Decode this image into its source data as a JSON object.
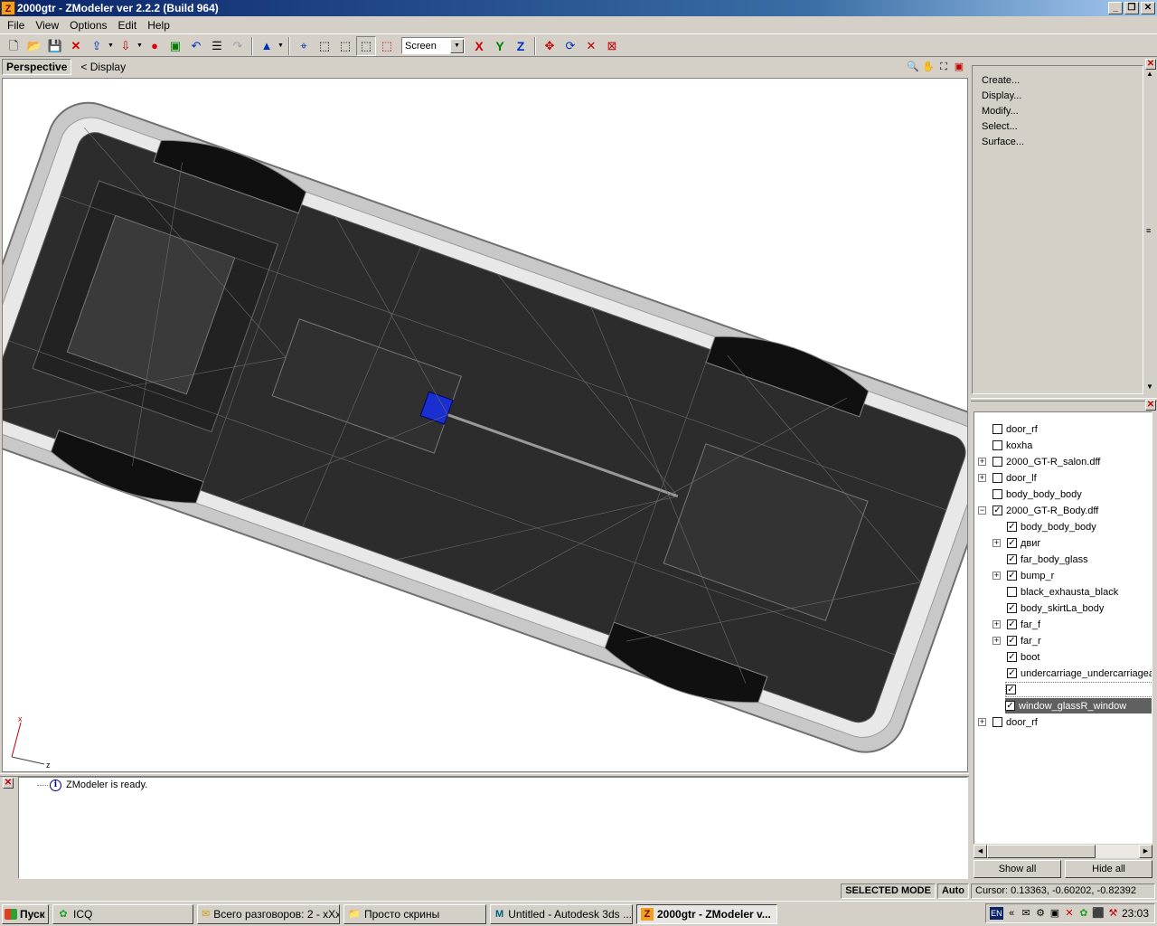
{
  "window": {
    "title": "2000gtr - ZModeler ver 2.2.2 (Build 964)",
    "app_icon": "Z"
  },
  "menu": [
    "File",
    "View",
    "Options",
    "Edit",
    "Help"
  ],
  "toolbar": {
    "view_mode": "Screen",
    "x_label": "X",
    "y_label": "Y",
    "z_label": "Z"
  },
  "viewport": {
    "name": "Perspective",
    "display_label": "< Display",
    "axis_x": "x",
    "axis_z": "z"
  },
  "log": {
    "message": "ZModeler is ready."
  },
  "commands": [
    "Create...",
    "Display...",
    "Modify...",
    "Select...",
    "Surface..."
  ],
  "tree": [
    {
      "label": "door_rf",
      "checked": false,
      "level": 0,
      "expander": false,
      "selected": false
    },
    {
      "label": "koxha",
      "checked": false,
      "level": 0,
      "expander": false,
      "selected": false
    },
    {
      "label": "2000_GT-R_salon.dff",
      "checked": false,
      "level": 0,
      "expander": "+",
      "selected": false
    },
    {
      "label": "door_lf",
      "checked": false,
      "level": 0,
      "expander": "+",
      "selected": false
    },
    {
      "label": "body_body_body",
      "checked": false,
      "level": 0,
      "expander": false,
      "selected": false
    },
    {
      "label": "2000_GT-R_Body.dff",
      "checked": true,
      "level": 0,
      "expander": "-",
      "selected": false
    },
    {
      "label": "body_body_body",
      "checked": true,
      "level": 1,
      "expander": false,
      "selected": false
    },
    {
      "label": "двиг",
      "checked": true,
      "level": 1,
      "expander": "+",
      "selected": false
    },
    {
      "label": "far_body_glass",
      "checked": true,
      "level": 1,
      "expander": false,
      "selected": false
    },
    {
      "label": "bump_r",
      "checked": true,
      "level": 1,
      "expander": "+",
      "selected": false
    },
    {
      "label": "black_exhausta_black",
      "checked": false,
      "level": 1,
      "expander": false,
      "selected": false
    },
    {
      "label": "body_skirtLa_body",
      "checked": true,
      "level": 1,
      "expander": false,
      "selected": false
    },
    {
      "label": "far_f",
      "checked": true,
      "level": 1,
      "expander": "+",
      "selected": false
    },
    {
      "label": "far_r",
      "checked": true,
      "level": 1,
      "expander": "+",
      "selected": false
    },
    {
      "label": "boot",
      "checked": true,
      "level": 1,
      "expander": false,
      "selected": false
    },
    {
      "label": "undercarriage_undercarriagea_",
      "checked": true,
      "level": 1,
      "expander": false,
      "selected": false
    },
    {
      "label": "",
      "checked": true,
      "level": 1,
      "expander": false,
      "selected": "dim"
    },
    {
      "label": "window_glassR_window",
      "checked": true,
      "level": 1,
      "expander": false,
      "selected": true
    },
    {
      "label": "door_rf",
      "checked": false,
      "level": 0,
      "expander": "+",
      "selected": false
    }
  ],
  "tree_buttons": {
    "show_all": "Show all",
    "hide_all": "Hide all"
  },
  "status": {
    "mode": "SELECTED MODE",
    "auto": "Auto",
    "cursor": "Cursor: 0.13363, -0.60202, -0.82392"
  },
  "taskbar": {
    "start": "Пуск",
    "tasks": [
      {
        "label": "ICQ",
        "icon": "flower-icon",
        "active": false
      },
      {
        "label": "Всего разговоров: 2 - xXx",
        "icon": "chat-icon",
        "active": false
      },
      {
        "label": "Просто скрины",
        "icon": "folder-icon",
        "active": false
      },
      {
        "label": "Untitled - Autodesk 3ds ...",
        "icon": "3ds-icon",
        "active": false
      },
      {
        "label": "2000gtr - ZModeler v...",
        "icon": "zmodeler-icon",
        "active": true
      }
    ],
    "lang": "EN",
    "time": "23:03"
  }
}
